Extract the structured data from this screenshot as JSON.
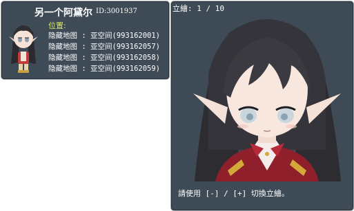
{
  "npc": {
    "name": "另一个阿黛尔",
    "id_label": "ID:3001937"
  },
  "location": {
    "header": "位置:",
    "entries": [
      "隐藏地图 : 亚空间(993162001)",
      "隐藏地图 : 亚空间(993162057)",
      "隐藏地图 : 亚空间(993162058)",
      "隐藏地图 : 亚空间(993162059)"
    ]
  },
  "portrait": {
    "counter": "立繪: 1 / 10",
    "hint": "請使用 [-] / [+] 切換立繪。"
  },
  "colors": {
    "panel_bg": "#3e4a55",
    "location_header": "#d8e86a",
    "text": "#ffffff"
  }
}
